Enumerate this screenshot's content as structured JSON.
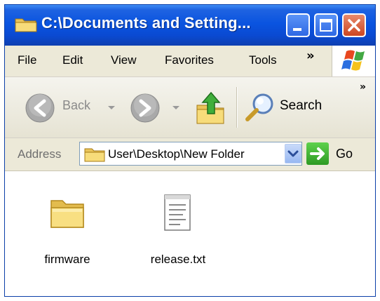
{
  "window": {
    "title": "C:\\Documents and Setting...",
    "controls": [
      "minimize-button",
      "maximize-button",
      "close-button"
    ]
  },
  "menu": {
    "items": [
      "File",
      "Edit",
      "View",
      "Favorites",
      "Tools"
    ],
    "overflow": "»"
  },
  "toolbar": {
    "back_label": "Back",
    "search_label": "Search",
    "overflow": "»"
  },
  "address": {
    "label": "Address",
    "value": "User\\Desktop\\New Folder",
    "go_label": "Go"
  },
  "files": [
    {
      "name": "firmware",
      "type": "folder"
    },
    {
      "name": "release.txt",
      "type": "text-file"
    }
  ],
  "colors": {
    "titlebar": "#0a54e0",
    "menu_bg": "#ece9d8",
    "close": "#cc4621",
    "go": "#2e9a24"
  }
}
